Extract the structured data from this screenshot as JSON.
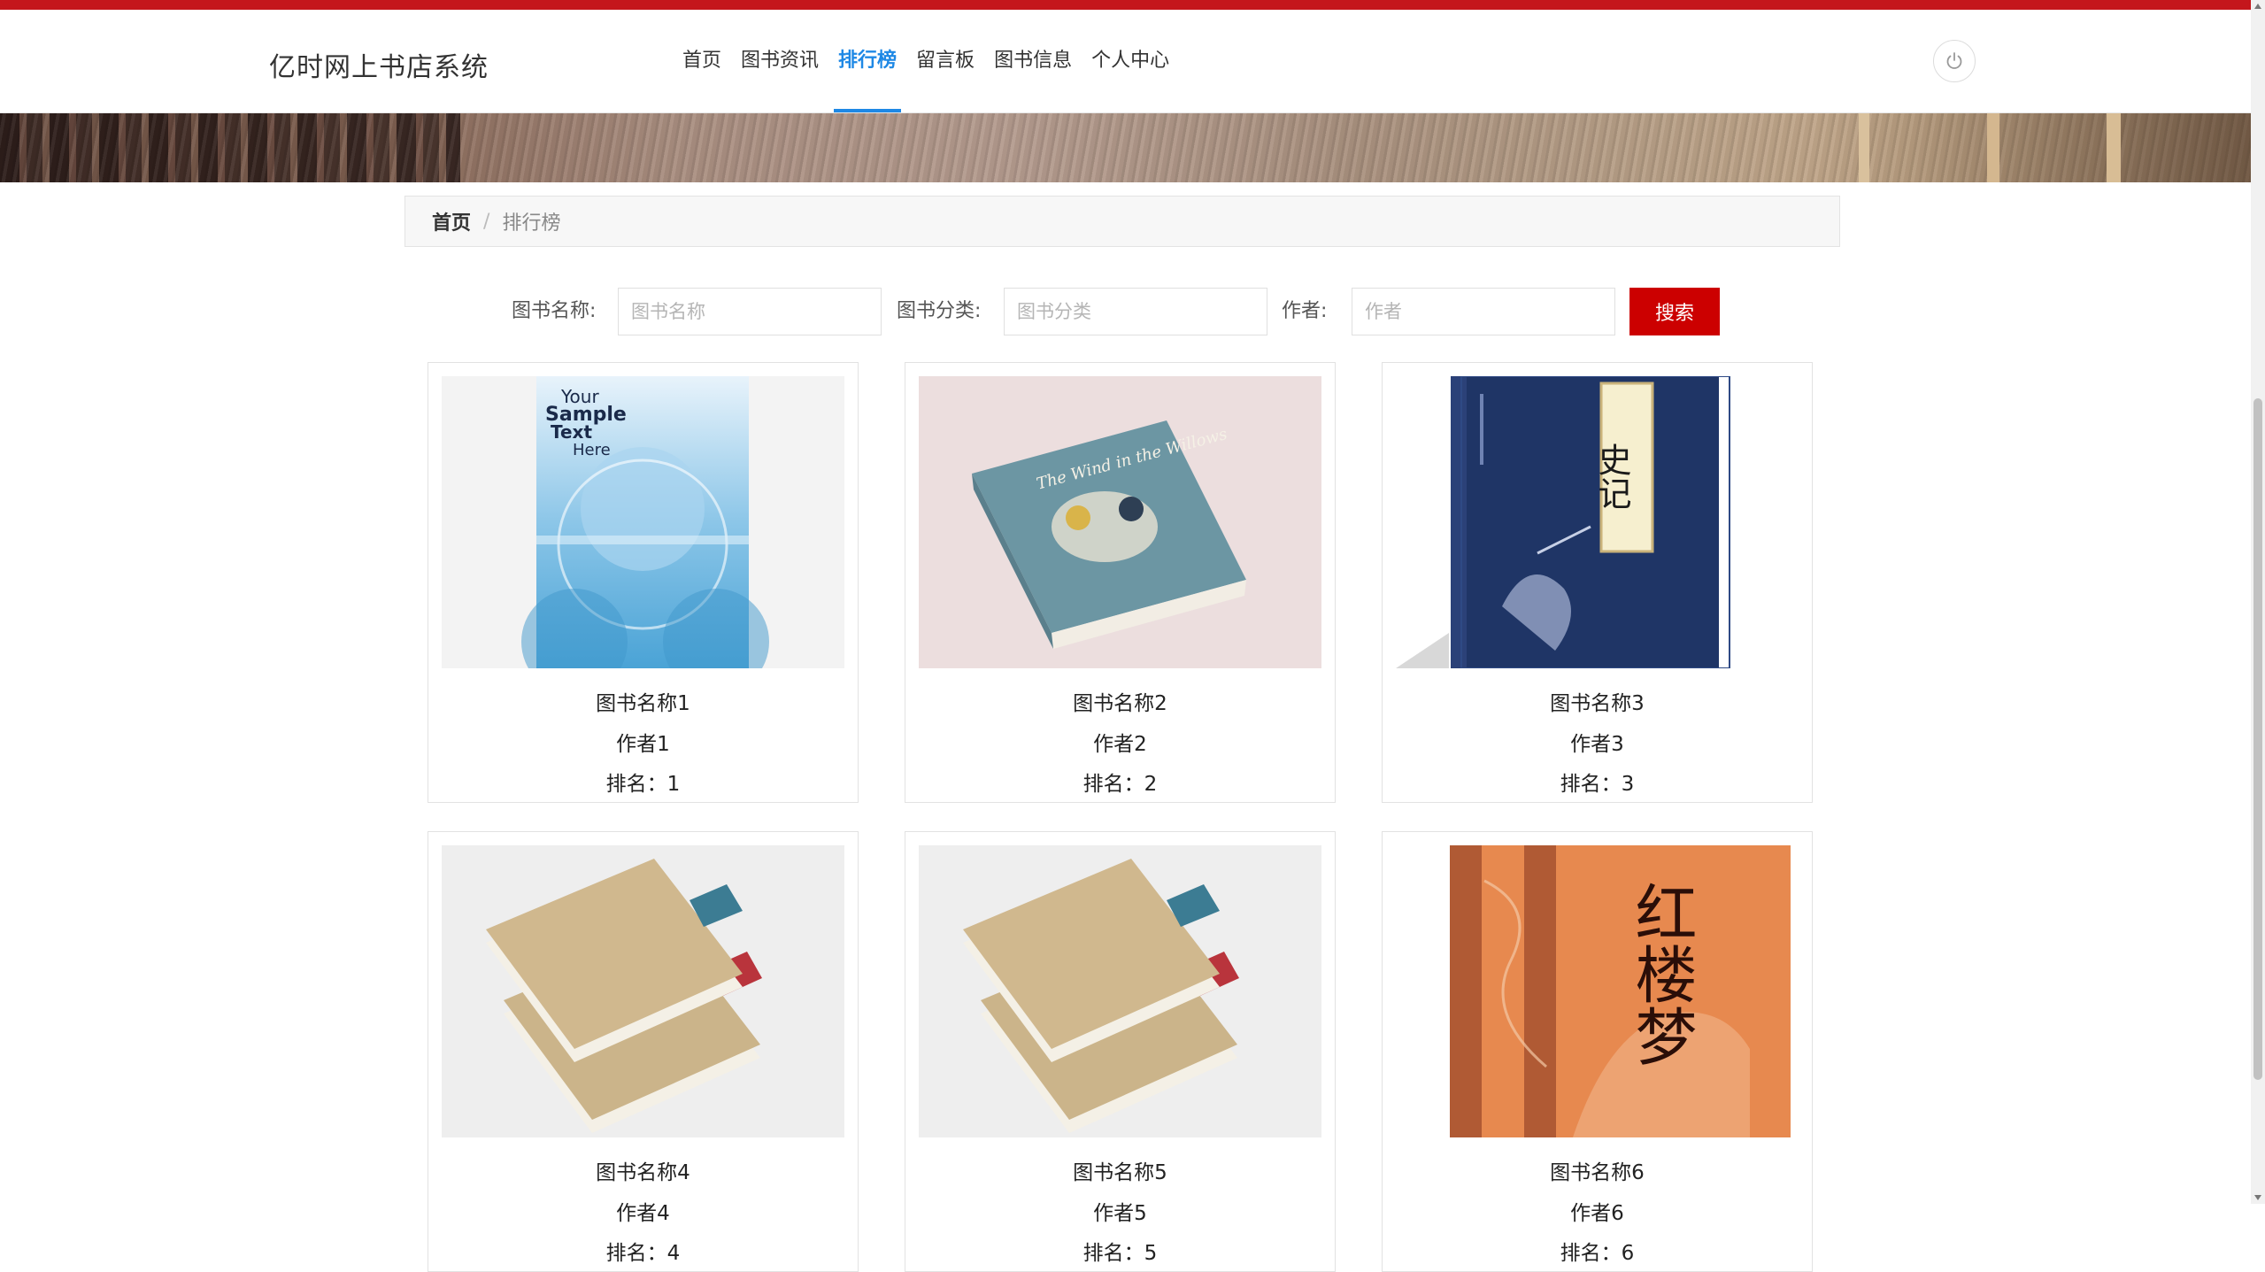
{
  "header": {
    "brand": "亿时网上书店系统",
    "nav": [
      {
        "label": "首页",
        "active": false
      },
      {
        "label": "图书资讯",
        "active": false
      },
      {
        "label": "排行榜",
        "active": true
      },
      {
        "label": "留言板",
        "active": false
      },
      {
        "label": "图书信息",
        "active": false
      },
      {
        "label": "个人中心",
        "active": false
      }
    ],
    "power_icon": "power-icon"
  },
  "breadcrumb": {
    "home": "首页",
    "separator": "/",
    "current": "排行榜"
  },
  "search": {
    "name_label": "图书名称:",
    "name_placeholder": "图书名称",
    "category_label": "图书分类:",
    "category_placeholder": "图书分类",
    "author_label": "作者:",
    "author_placeholder": "作者",
    "button_label": "搜索"
  },
  "books": [
    {
      "title": "图书名称1",
      "author": "作者1",
      "rank": "排名：1"
    },
    {
      "title": "图书名称2",
      "author": "作者2",
      "rank": "排名：2"
    },
    {
      "title": "图书名称3",
      "author": "作者3",
      "rank": "排名：3"
    },
    {
      "title": "图书名称4",
      "author": "作者4",
      "rank": "排名：4"
    },
    {
      "title": "图书名称5",
      "author": "作者5",
      "rank": "排名：5"
    },
    {
      "title": "图书名称6",
      "author": "作者6",
      "rank": "排名：6"
    }
  ],
  "covers": {
    "c1": {
      "line1": "Your",
      "line2": "Sample",
      "line3": "Text",
      "line4": "Here"
    },
    "c2": {
      "title": "The Wind in the Willows"
    },
    "c3": {
      "title": "史记"
    },
    "c6": {
      "title": "红楼梦"
    }
  },
  "colors": {
    "accent": "#cc0000",
    "active_nav": "#1e88e5",
    "top_bar": "#c4161c"
  }
}
